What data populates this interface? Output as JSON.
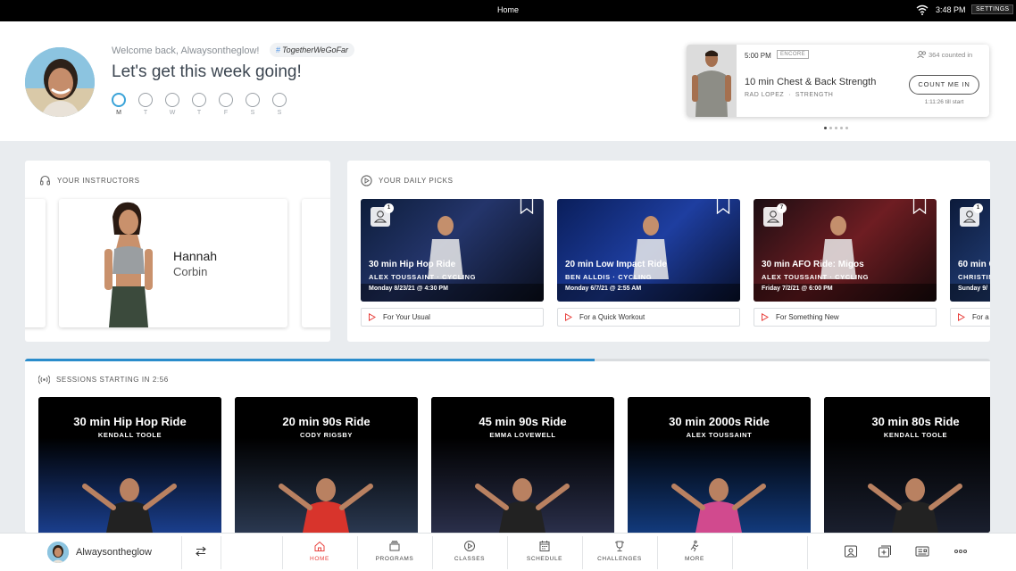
{
  "status_bar": {
    "title": "Home",
    "time": "3:48 PM",
    "settings_label": "SETTINGS"
  },
  "header": {
    "welcome": "Welcome back, Alwaysontheglow!",
    "hashtag": "TogetherWeGoFar",
    "headline": "Let's get this week going!",
    "days": [
      "M",
      "T",
      "W",
      "T",
      "F",
      "S",
      "S"
    ],
    "active_day": "M"
  },
  "live_class": {
    "time": "5:00 PM",
    "tag": "ENCORE",
    "counted": "364 counted in",
    "title": "10 min Chest & Back Strength",
    "instructor": "RAD LOPEZ",
    "category": "STRENGTH",
    "button": "COUNT ME IN",
    "countdown": "1:11:26 till start",
    "carousel_pages": 5,
    "carousel_active": 1
  },
  "instructors": {
    "title": "YOUR INSTRUCTORS",
    "featured": {
      "first": "Hannah",
      "last": "Corbin"
    }
  },
  "daily_picks": {
    "title": "YOUR DAILY PICKS",
    "items": [
      {
        "title": "30 min Hip Hop Ride",
        "instructor": "ALEX TOUSSAINT",
        "category": "CYCLING",
        "date": "Monday 8/23/21 @ 4:30 PM",
        "badge": "1",
        "label": "For Your Usual"
      },
      {
        "title": "20 min Low Impact Ride",
        "instructor": "BEN ALLDIS",
        "category": "CYCLING",
        "date": "Monday 6/7/21 @ 2:55 AM",
        "badge": "",
        "label": "For a Quick Workout"
      },
      {
        "title": "30 min AFO Ride: Migos",
        "instructor": "ALEX TOUSSAINT",
        "category": "CYCLING",
        "date": "Friday 7/2/21 @ 6:00 PM",
        "badge": "7",
        "label": "For Something New"
      },
      {
        "title": "60 min C",
        "instructor": "CHRISTIN",
        "category": "",
        "date": "Sunday 9/",
        "badge": "1",
        "label": "For a"
      }
    ]
  },
  "sessions": {
    "title": "SESSIONS STARTING IN 2:56",
    "progress": 0.59,
    "items": [
      {
        "title": "30 min Hip Hop Ride",
        "instructor": "KENDALL TOOLE"
      },
      {
        "title": "20 min 90s Ride",
        "instructor": "CODY RIGSBY"
      },
      {
        "title": "45 min 90s Ride",
        "instructor": "EMMA LOVEWELL"
      },
      {
        "title": "30 min 2000s Ride",
        "instructor": "ALEX TOUSSAINT"
      },
      {
        "title": "30 min 80s Ride",
        "instructor": "KENDALL TOOLE"
      }
    ]
  },
  "bottom_nav": {
    "username": "Alwaysontheglow",
    "items": [
      "HOME",
      "PROGRAMS",
      "CLASSES",
      "SCHEDULE",
      "CHALLENGES",
      "MORE"
    ],
    "active": "HOME"
  },
  "colors": {
    "accent_blue": "#2a8ccb",
    "accent_red": "#e8413d",
    "background": "#e9ecef"
  }
}
